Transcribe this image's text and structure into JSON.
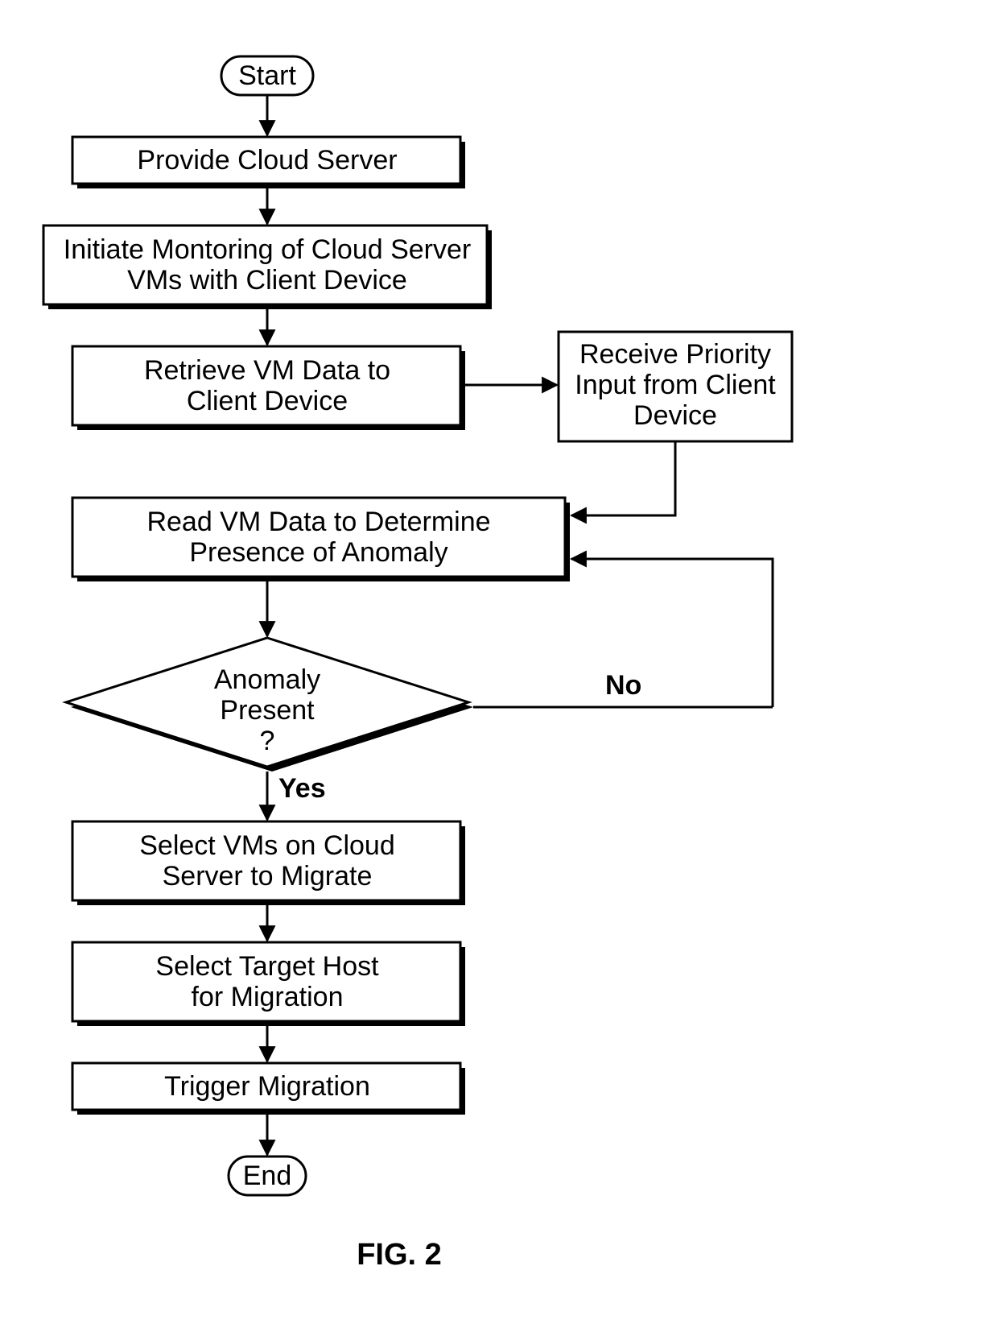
{
  "caption": "FIG. 2",
  "start": {
    "label": "Start"
  },
  "end": {
    "label": "End"
  },
  "steps": {
    "provide_cloud": "Provide Cloud Server",
    "initiate_monitor_l1": "Initiate Montoring of Cloud Server",
    "initiate_monitor_l2": "VMs with Client Device",
    "retrieve_vm_l1": "Retrieve VM Data to",
    "retrieve_vm_l2": "Client Device",
    "priority_l1": "Receive Priority",
    "priority_l2": "Input from Client",
    "priority_l3": "Device",
    "read_vm_l1": "Read VM Data to Determine",
    "read_vm_l2": "Presence of Anomaly",
    "select_vm_l1": "Select VMs on Cloud",
    "select_vm_l2": "Server to Migrate",
    "select_target_l1": "Select Target Host",
    "select_target_l2": "for Migration",
    "trigger": "Trigger Migration"
  },
  "decision": {
    "l1": "Anomaly",
    "l2": "Present",
    "l3": "?",
    "yes": "Yes",
    "no": "No"
  }
}
